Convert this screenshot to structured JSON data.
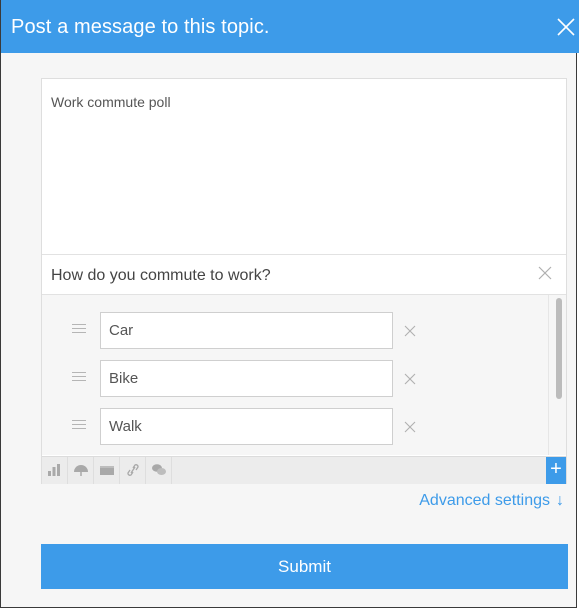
{
  "dialog": {
    "title": "Post a message to this topic."
  },
  "message": {
    "text": "Work commute poll"
  },
  "poll": {
    "question": "How do you commute to work?",
    "options": [
      {
        "label": "Car"
      },
      {
        "label": "Bike"
      },
      {
        "label": "Walk"
      }
    ]
  },
  "toolbar": {
    "tools": [
      "bar-chart-icon",
      "umbrella-icon",
      "image-icon",
      "link-icon",
      "chat-icon"
    ],
    "add_label": "+"
  },
  "advanced": {
    "label": "Advanced settings",
    "arrow": "↓"
  },
  "submit": {
    "label": "Submit"
  },
  "colors": {
    "accent": "#3d9be9",
    "panel": "#f6f6f6"
  }
}
